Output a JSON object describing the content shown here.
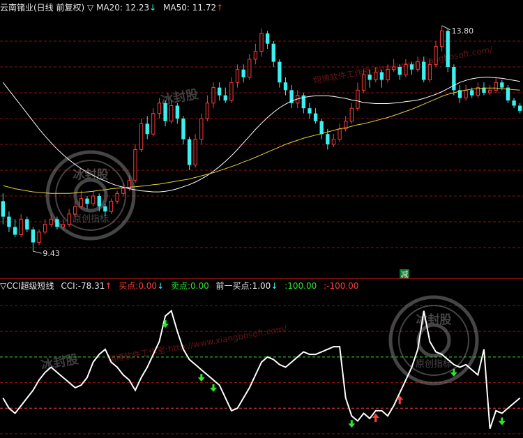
{
  "colors": {
    "background": "#000000",
    "up": "#ff3c3c",
    "down": "#3cf0f0",
    "ma20": "#ffffff",
    "ma50": "#e6d23a",
    "grid": "#8b1010",
    "cci": "#ffffff",
    "buy_level": "#2ee62e",
    "sell_level": "#ff3c3c"
  },
  "header": {
    "symbol": "云南锗业(日线 前复权)",
    "toggle_icon": "triangle-down-icon",
    "ma20_label": "MA20:",
    "ma20_value": "12.23",
    "ma50_label": "MA50:",
    "ma50_value": "11.72"
  },
  "indicator_header": {
    "name": "CCI超级短线",
    "cci_label": "CCI:",
    "cci_value": "-78.31",
    "buy_label": "买点:",
    "buy_value": "0.00",
    "sell_label": "卖点:",
    "sell_value": "0.00",
    "prev_label": "前一买点:",
    "prev_value": "1.00",
    "level_up": "100.00",
    "level_dn": "-100.00"
  },
  "badge": "减",
  "watermark": {
    "url": "翔博软件工作室:http://www.xiangbosoft.com/",
    "seal": "冰封股",
    "seal_sub": "原创指标"
  },
  "chart_data": [
    {
      "type": "candlestick",
      "title": "云南锗业(日线 前复权)",
      "ylim": [
        9.0,
        14.0
      ],
      "max_label": "13.80",
      "min_label": "9.43",
      "grid": true,
      "series": [
        {
          "name": "MA20",
          "values": [
            12.7,
            12.55,
            12.4,
            12.25,
            12.1,
            11.95,
            11.8,
            11.66,
            11.53,
            11.41,
            11.3,
            11.2,
            11.11,
            11.03,
            10.96,
            10.9,
            10.84,
            10.79,
            10.74,
            10.7,
            10.67,
            10.64,
            10.62,
            10.6,
            10.59,
            10.58,
            10.58,
            10.59,
            10.61,
            10.64,
            10.68,
            10.72,
            10.77,
            10.83,
            10.9,
            10.98,
            11.07,
            11.17,
            11.28,
            11.4,
            11.53,
            11.66,
            11.79,
            11.91,
            12.02,
            12.12,
            12.21,
            12.28,
            12.34,
            12.38,
            12.41,
            12.43,
            12.44,
            12.44,
            12.44,
            12.43,
            12.41,
            12.39,
            12.36,
            12.34,
            12.31,
            12.3,
            12.29,
            12.29,
            12.29,
            12.3,
            12.31,
            12.33,
            12.34,
            12.36,
            12.39,
            12.43,
            12.47,
            12.52,
            12.58,
            12.64,
            12.7,
            12.74,
            12.77,
            12.79,
            12.8,
            12.8,
            12.79,
            12.78,
            12.76,
            12.74,
            12.72
          ]
        },
        {
          "name": "MA50",
          "values": [
            10.7,
            10.67,
            10.64,
            10.62,
            10.6,
            10.58,
            10.57,
            10.56,
            10.55,
            10.55,
            10.55,
            10.55,
            10.56,
            10.57,
            10.58,
            10.59,
            10.61,
            10.62,
            10.64,
            10.65,
            10.66,
            10.67,
            10.68,
            10.69,
            10.7,
            10.72,
            10.73,
            10.75,
            10.77,
            10.79,
            10.81,
            10.83,
            10.86,
            10.89,
            10.92,
            10.95,
            10.99,
            11.03,
            11.07,
            11.11,
            11.16,
            11.2,
            11.25,
            11.3,
            11.35,
            11.4,
            11.45,
            11.5,
            11.54,
            11.58,
            11.62,
            11.65,
            11.68,
            11.71,
            11.74,
            11.77,
            11.8,
            11.82,
            11.85,
            11.88,
            11.9,
            11.93,
            11.96,
            11.99,
            12.02,
            12.06,
            12.1,
            12.14,
            12.18,
            12.23,
            12.28,
            12.33,
            12.38,
            12.43,
            12.47,
            12.5,
            12.53,
            12.55,
            12.57,
            12.58,
            12.59,
            12.59,
            12.59,
            12.58,
            12.57,
            12.56,
            12.55
          ]
        }
      ],
      "candles": [
        [
          10.4,
          10.1,
          10.55,
          9.95
        ],
        [
          10.1,
          9.9,
          10.2,
          9.8
        ],
        [
          9.9,
          9.75,
          10.05,
          9.7
        ],
        [
          9.75,
          10.05,
          10.15,
          9.7
        ],
        [
          10.05,
          9.85,
          10.1,
          9.8
        ],
        [
          9.85,
          9.6,
          9.9,
          9.43
        ],
        [
          9.6,
          9.8,
          9.85,
          9.55
        ],
        [
          9.8,
          9.95,
          10.05,
          9.75
        ],
        [
          9.95,
          10.05,
          10.15,
          9.9
        ],
        [
          10.05,
          9.9,
          10.1,
          9.85
        ],
        [
          9.9,
          9.95,
          10.05,
          9.85
        ],
        [
          9.95,
          10.15,
          10.25,
          9.9
        ],
        [
          10.15,
          10.3,
          10.4,
          10.1
        ],
        [
          10.3,
          10.45,
          10.6,
          10.25
        ],
        [
          10.45,
          10.35,
          10.5,
          10.25
        ],
        [
          10.35,
          10.5,
          10.6,
          10.3
        ],
        [
          10.5,
          10.3,
          10.55,
          10.2
        ],
        [
          10.3,
          10.2,
          10.35,
          10.1
        ],
        [
          10.2,
          10.4,
          10.45,
          10.15
        ],
        [
          10.4,
          10.55,
          10.6,
          10.35
        ],
        [
          10.55,
          10.65,
          10.75,
          10.5
        ],
        [
          10.65,
          10.8,
          10.9,
          10.6
        ],
        [
          10.8,
          11.4,
          11.5,
          10.75
        ],
        [
          11.4,
          11.9,
          12.0,
          11.35
        ],
        [
          11.9,
          11.7,
          12.05,
          11.6
        ],
        [
          11.7,
          12.1,
          12.2,
          11.65
        ],
        [
          12.1,
          12.3,
          12.4,
          12.0
        ],
        [
          12.3,
          11.95,
          12.35,
          11.85
        ],
        [
          11.95,
          12.25,
          12.35,
          11.9
        ],
        [
          12.25,
          12.0,
          12.3,
          11.9
        ],
        [
          12.0,
          11.6,
          12.05,
          11.5
        ],
        [
          11.6,
          11.1,
          11.65,
          11.0
        ],
        [
          11.1,
          11.6,
          11.7,
          11.05
        ],
        [
          11.6,
          12.0,
          12.1,
          11.5
        ],
        [
          12.0,
          12.3,
          12.45,
          11.95
        ],
        [
          12.3,
          12.6,
          12.7,
          12.2
        ],
        [
          12.6,
          12.45,
          12.7,
          12.35
        ],
        [
          12.45,
          12.35,
          12.6,
          12.3
        ],
        [
          12.35,
          12.7,
          12.8,
          12.3
        ],
        [
          12.7,
          12.95,
          13.05,
          12.6
        ],
        [
          12.95,
          12.8,
          13.05,
          12.7
        ],
        [
          12.8,
          13.15,
          13.25,
          12.75
        ],
        [
          13.15,
          13.3,
          13.45,
          13.05
        ],
        [
          13.3,
          13.65,
          13.75,
          13.2
        ],
        [
          13.65,
          13.45,
          13.7,
          13.35
        ],
        [
          13.45,
          13.1,
          13.5,
          13.0
        ],
        [
          13.1,
          12.7,
          13.15,
          12.6
        ],
        [
          12.7,
          12.55,
          12.8,
          12.45
        ],
        [
          12.55,
          12.3,
          12.65,
          12.2
        ],
        [
          12.3,
          12.45,
          12.55,
          12.2
        ],
        [
          12.45,
          12.2,
          12.5,
          12.1
        ],
        [
          12.2,
          12.1,
          12.3,
          12.0
        ],
        [
          12.1,
          11.95,
          12.2,
          11.9
        ],
        [
          11.95,
          11.7,
          12.0,
          11.6
        ],
        [
          11.7,
          11.5,
          11.8,
          11.4
        ],
        [
          11.5,
          11.6,
          11.7,
          11.45
        ],
        [
          11.6,
          11.8,
          11.9,
          11.55
        ],
        [
          11.8,
          11.95,
          12.05,
          11.75
        ],
        [
          11.95,
          12.2,
          12.3,
          11.9
        ],
        [
          12.2,
          12.55,
          12.7,
          12.15
        ],
        [
          12.55,
          12.85,
          12.95,
          12.5
        ],
        [
          12.85,
          12.75,
          12.95,
          12.6
        ],
        [
          12.75,
          12.9,
          13.0,
          12.7
        ],
        [
          12.9,
          12.75,
          12.95,
          12.6
        ],
        [
          12.75,
          12.95,
          13.05,
          12.7
        ],
        [
          12.95,
          13.0,
          13.15,
          12.9
        ],
        [
          13.0,
          12.85,
          13.05,
          12.75
        ],
        [
          12.85,
          13.05,
          13.15,
          12.8
        ],
        [
          13.05,
          12.95,
          13.1,
          12.85
        ],
        [
          12.95,
          13.1,
          13.2,
          12.9
        ],
        [
          13.1,
          12.75,
          13.2,
          12.7
        ],
        [
          12.75,
          13.05,
          13.15,
          12.7
        ],
        [
          13.05,
          13.4,
          13.5,
          13.0
        ],
        [
          13.4,
          13.7,
          13.8,
          13.3
        ],
        [
          13.7,
          13.0,
          13.75,
          12.9
        ],
        [
          13.0,
          12.55,
          13.05,
          12.45
        ],
        [
          12.55,
          12.4,
          12.65,
          12.3
        ],
        [
          12.4,
          12.55,
          12.65,
          12.35
        ],
        [
          12.55,
          12.45,
          12.6,
          12.4
        ],
        [
          12.45,
          12.6,
          12.7,
          12.4
        ],
        [
          12.6,
          12.5,
          12.7,
          12.45
        ],
        [
          12.5,
          12.55,
          12.65,
          12.45
        ],
        [
          12.55,
          12.7,
          12.8,
          12.5
        ],
        [
          12.7,
          12.6,
          12.75,
          12.55
        ],
        [
          12.6,
          12.35,
          12.65,
          12.3
        ],
        [
          12.35,
          12.25,
          12.4,
          12.2
        ],
        [
          12.25,
          12.15,
          12.3,
          12.1
        ]
      ]
    },
    {
      "type": "line",
      "title": "CCI超级短线",
      "ylim": [
        -200,
        350
      ],
      "levels": [
        100,
        -100
      ],
      "series": [
        {
          "name": "CCI",
          "values": [
            -60,
            -100,
            -120,
            -90,
            -60,
            -30,
            10,
            40,
            60,
            40,
            20,
            0,
            -20,
            -10,
            20,
            80,
            110,
            130,
            80,
            60,
            30,
            10,
            -30,
            20,
            60,
            110,
            160,
            260,
            280,
            200,
            130,
            90,
            70,
            50,
            30,
            10,
            -10,
            -60,
            -110,
            -100,
            -60,
            -20,
            30,
            80,
            100,
            90,
            70,
            60,
            80,
            100,
            120,
            110,
            110,
            120,
            130,
            140,
            140,
            -60,
            -130,
            -150,
            -120,
            -140,
            -110,
            -110,
            -130,
            -90,
            -40,
            10,
            60,
            130,
            280,
            160,
            120,
            110,
            90,
            70,
            60,
            70,
            50,
            30,
            130,
            -180,
            -110,
            -120,
            -100,
            -80,
            -60
          ]
        }
      ],
      "buy_points": [
        27,
        33,
        35,
        58,
        75,
        83
      ],
      "sell_points": [
        62,
        66
      ]
    }
  ]
}
